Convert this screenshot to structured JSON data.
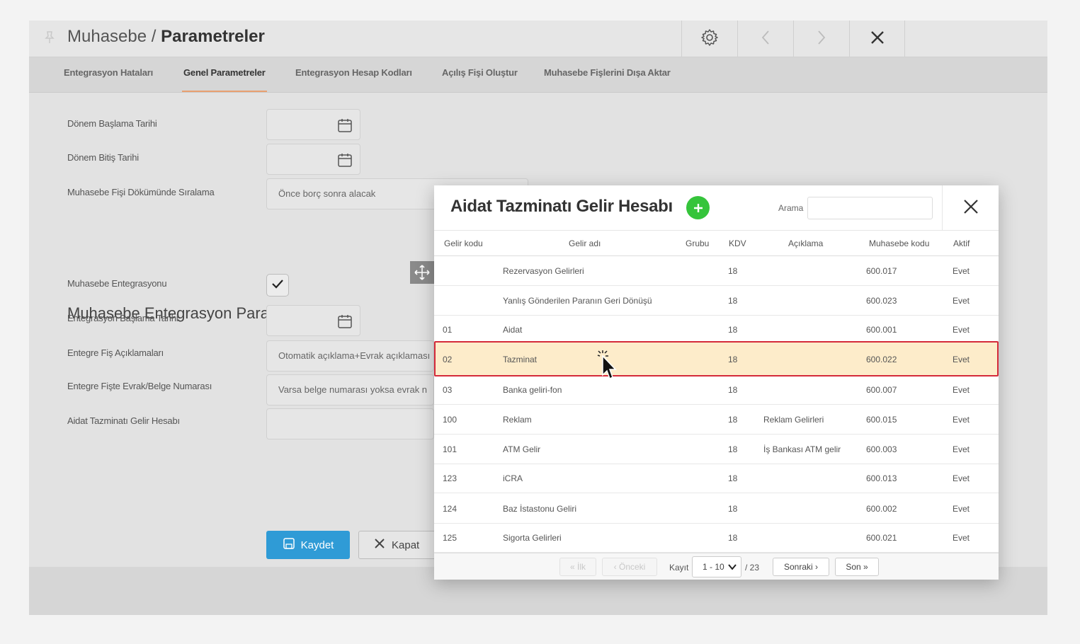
{
  "titlebar": {
    "module": "Muhasebe",
    "separator": " / ",
    "page": "Parametreler",
    "icons": {
      "pin": "pin-icon",
      "settings": "gear-icon",
      "prev": "chevron-left-icon",
      "next": "chevron-right-icon",
      "close": "close-icon"
    }
  },
  "tabs": [
    {
      "label": "Entegrasyon Hataları",
      "active": false
    },
    {
      "label": "Genel Parametreler",
      "active": true
    },
    {
      "label": "Entegrasyon Hesap Kodları",
      "active": false
    },
    {
      "label": "Açılış Fişi Oluştur",
      "active": false
    },
    {
      "label": "Muhasebe Fişlerini Dışa Aktar",
      "active": false
    }
  ],
  "form": {
    "period_start_label": "Dönem Başlama Tarihi",
    "period_end_label": "Dönem Bitiş Tarihi",
    "sort_label": "Muhasebe Fişi Dökümünde Sıralama",
    "sort_value": "Önce borç sonra alacak",
    "section_title": "Muhasebe Entegrasyon Parametreleri",
    "integration_label": "Muhasebe Entegrasyonu",
    "integration_checked": true,
    "integration_start_label": "Entegrasyon Başlama Tarihi",
    "slip_desc_label": "Entegre Fiş Açıklamaları",
    "slip_desc_value": "Otomatik açıklama+Evrak açıklaması",
    "doc_number_label": "Entegre Fişte Evrak/Belge Numarası",
    "doc_number_value": "Varsa belge numarası yoksa evrak n",
    "income_account_label": "Aidat Tazminatı Gelir Hesabı",
    "save_label": "Kaydet",
    "close_label": "Kapat"
  },
  "modal": {
    "title": "Aidat Tazminatı Gelir Hesabı",
    "search_label": "Arama",
    "search_value": "",
    "columns": [
      "Gelir kodu",
      "Gelir adı",
      "Grubu",
      "KDV",
      "Açıklama",
      "Muhasebe kodu",
      "Aktif"
    ],
    "rows": [
      {
        "code": "",
        "name": "Rezervasyon Gelirleri",
        "group": "",
        "kdv": "18",
        "desc": "",
        "acc": "600.017",
        "active": "Evet",
        "selected": false
      },
      {
        "code": "",
        "name": "Yanlış Gönderilen Paranın Geri Dönüşü",
        "group": "",
        "kdv": "18",
        "desc": "",
        "acc": "600.023",
        "active": "Evet",
        "selected": false
      },
      {
        "code": "01",
        "name": "Aidat",
        "group": "",
        "kdv": "18",
        "desc": "",
        "acc": "600.001",
        "active": "Evet",
        "selected": false
      },
      {
        "code": "02",
        "name": "Tazminat",
        "group": "",
        "kdv": "18",
        "desc": "",
        "acc": "600.022",
        "active": "Evet",
        "selected": true
      },
      {
        "code": "03",
        "name": "Banka geliri-fon",
        "group": "",
        "kdv": "18",
        "desc": "",
        "acc": "600.007",
        "active": "Evet",
        "selected": false
      },
      {
        "code": "100",
        "name": "Reklam",
        "group": "",
        "kdv": "18",
        "desc": "Reklam Gelirleri",
        "acc": "600.015",
        "active": "Evet",
        "selected": false
      },
      {
        "code": "101",
        "name": "ATM Gelir",
        "group": "",
        "kdv": "18",
        "desc": "İş Bankası ATM gelir",
        "acc": "600.003",
        "active": "Evet",
        "selected": false
      },
      {
        "code": "123",
        "name": "iCRA",
        "group": "",
        "kdv": "18",
        "desc": "",
        "acc": "600.013",
        "active": "Evet",
        "selected": false
      },
      {
        "code": "124",
        "name": "Baz İstastonu Geliri",
        "group": "",
        "kdv": "18",
        "desc": "",
        "acc": "600.002",
        "active": "Evet",
        "selected": false
      },
      {
        "code": "125",
        "name": "Sigorta Gelirleri",
        "group": "",
        "kdv": "18",
        "desc": "",
        "acc": "600.021",
        "active": "Evet",
        "selected": false
      }
    ],
    "pager": {
      "first": "« İlk",
      "prev": "‹ Önceki",
      "record_label": "Kayıt",
      "range": "1 - 10",
      "total": "/ 23",
      "next": "Sonraki ›",
      "last": "Son »"
    }
  },
  "colors": {
    "accent_blue": "#2f9bd6",
    "add_green": "#35c43b",
    "selected_row": "#fdecca",
    "selected_border": "#d42a3a"
  }
}
